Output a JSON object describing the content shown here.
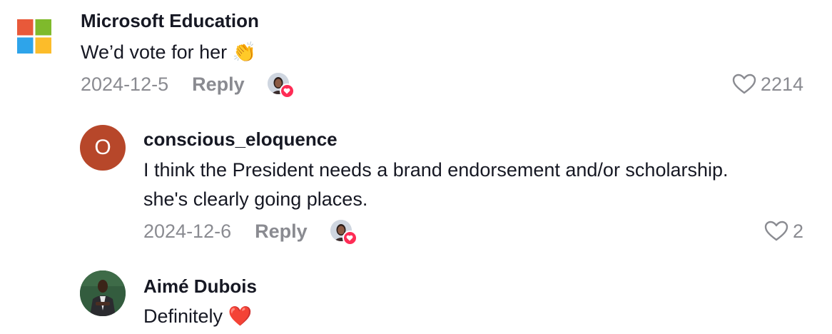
{
  "comments": [
    {
      "username": "Microsoft Education",
      "text": "We’d vote for her",
      "emoji": "👏",
      "date": "2024-12-5",
      "reply_label": "Reply",
      "likes": "2214",
      "avatar_icon": "microsoft-logo",
      "creator_liked": true
    },
    {
      "username": "conscious_eloquence",
      "text_line1": "I think the President needs a brand endorsement and/or scholarship.",
      "text_line2": "she's clearly going places.",
      "date": "2024-12-6",
      "reply_label": "Reply",
      "likes": "2",
      "avatar_letter": "O",
      "avatar_color": "#b7472a",
      "creator_liked": true
    },
    {
      "username": "Aimé Dubois",
      "text": "Definitely",
      "emoji": "❤️",
      "avatar_icon": "profile-photo"
    }
  ],
  "colors": {
    "username": "#161823",
    "meta": "#8a8b91",
    "heart_badge": "#fe2c55",
    "ms_red": "#f25022",
    "ms_green": "#7fba00",
    "ms_blue": "#00a4ef",
    "ms_yellow": "#ffb900"
  }
}
